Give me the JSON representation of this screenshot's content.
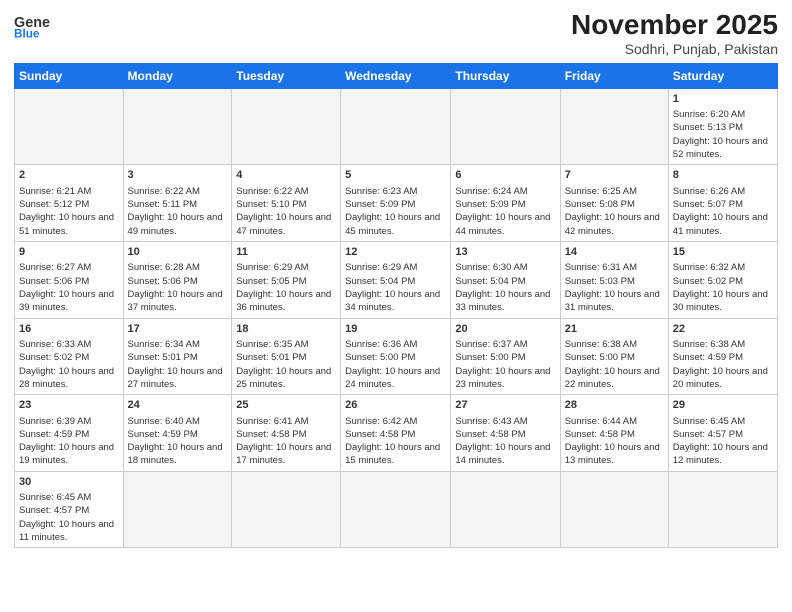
{
  "logo": {
    "text_general": "General",
    "text_blue": "Blue"
  },
  "header": {
    "month_year": "November 2025",
    "location": "Sodhri, Punjab, Pakistan"
  },
  "days_of_week": [
    "Sunday",
    "Monday",
    "Tuesday",
    "Wednesday",
    "Thursday",
    "Friday",
    "Saturday"
  ],
  "weeks": [
    [
      {
        "num": "",
        "info": ""
      },
      {
        "num": "",
        "info": ""
      },
      {
        "num": "",
        "info": ""
      },
      {
        "num": "",
        "info": ""
      },
      {
        "num": "",
        "info": ""
      },
      {
        "num": "",
        "info": ""
      },
      {
        "num": "1",
        "info": "Sunrise: 6:20 AM\nSunset: 5:13 PM\nDaylight: 10 hours and 52 minutes."
      }
    ],
    [
      {
        "num": "2",
        "info": "Sunrise: 6:21 AM\nSunset: 5:12 PM\nDaylight: 10 hours and 51 minutes."
      },
      {
        "num": "3",
        "info": "Sunrise: 6:22 AM\nSunset: 5:11 PM\nDaylight: 10 hours and 49 minutes."
      },
      {
        "num": "4",
        "info": "Sunrise: 6:22 AM\nSunset: 5:10 PM\nDaylight: 10 hours and 47 minutes."
      },
      {
        "num": "5",
        "info": "Sunrise: 6:23 AM\nSunset: 5:09 PM\nDaylight: 10 hours and 45 minutes."
      },
      {
        "num": "6",
        "info": "Sunrise: 6:24 AM\nSunset: 5:09 PM\nDaylight: 10 hours and 44 minutes."
      },
      {
        "num": "7",
        "info": "Sunrise: 6:25 AM\nSunset: 5:08 PM\nDaylight: 10 hours and 42 minutes."
      },
      {
        "num": "8",
        "info": "Sunrise: 6:26 AM\nSunset: 5:07 PM\nDaylight: 10 hours and 41 minutes."
      }
    ],
    [
      {
        "num": "9",
        "info": "Sunrise: 6:27 AM\nSunset: 5:06 PM\nDaylight: 10 hours and 39 minutes."
      },
      {
        "num": "10",
        "info": "Sunrise: 6:28 AM\nSunset: 5:06 PM\nDaylight: 10 hours and 37 minutes."
      },
      {
        "num": "11",
        "info": "Sunrise: 6:29 AM\nSunset: 5:05 PM\nDaylight: 10 hours and 36 minutes."
      },
      {
        "num": "12",
        "info": "Sunrise: 6:29 AM\nSunset: 5:04 PM\nDaylight: 10 hours and 34 minutes."
      },
      {
        "num": "13",
        "info": "Sunrise: 6:30 AM\nSunset: 5:04 PM\nDaylight: 10 hours and 33 minutes."
      },
      {
        "num": "14",
        "info": "Sunrise: 6:31 AM\nSunset: 5:03 PM\nDaylight: 10 hours and 31 minutes."
      },
      {
        "num": "15",
        "info": "Sunrise: 6:32 AM\nSunset: 5:02 PM\nDaylight: 10 hours and 30 minutes."
      }
    ],
    [
      {
        "num": "16",
        "info": "Sunrise: 6:33 AM\nSunset: 5:02 PM\nDaylight: 10 hours and 28 minutes."
      },
      {
        "num": "17",
        "info": "Sunrise: 6:34 AM\nSunset: 5:01 PM\nDaylight: 10 hours and 27 minutes."
      },
      {
        "num": "18",
        "info": "Sunrise: 6:35 AM\nSunset: 5:01 PM\nDaylight: 10 hours and 25 minutes."
      },
      {
        "num": "19",
        "info": "Sunrise: 6:36 AM\nSunset: 5:00 PM\nDaylight: 10 hours and 24 minutes."
      },
      {
        "num": "20",
        "info": "Sunrise: 6:37 AM\nSunset: 5:00 PM\nDaylight: 10 hours and 23 minutes."
      },
      {
        "num": "21",
        "info": "Sunrise: 6:38 AM\nSunset: 5:00 PM\nDaylight: 10 hours and 22 minutes."
      },
      {
        "num": "22",
        "info": "Sunrise: 6:38 AM\nSunset: 4:59 PM\nDaylight: 10 hours and 20 minutes."
      }
    ],
    [
      {
        "num": "23",
        "info": "Sunrise: 6:39 AM\nSunset: 4:59 PM\nDaylight: 10 hours and 19 minutes."
      },
      {
        "num": "24",
        "info": "Sunrise: 6:40 AM\nSunset: 4:59 PM\nDaylight: 10 hours and 18 minutes."
      },
      {
        "num": "25",
        "info": "Sunrise: 6:41 AM\nSunset: 4:58 PM\nDaylight: 10 hours and 17 minutes."
      },
      {
        "num": "26",
        "info": "Sunrise: 6:42 AM\nSunset: 4:58 PM\nDaylight: 10 hours and 15 minutes."
      },
      {
        "num": "27",
        "info": "Sunrise: 6:43 AM\nSunset: 4:58 PM\nDaylight: 10 hours and 14 minutes."
      },
      {
        "num": "28",
        "info": "Sunrise: 6:44 AM\nSunset: 4:58 PM\nDaylight: 10 hours and 13 minutes."
      },
      {
        "num": "29",
        "info": "Sunrise: 6:45 AM\nSunset: 4:57 PM\nDaylight: 10 hours and 12 minutes."
      }
    ],
    [
      {
        "num": "30",
        "info": "Sunrise: 6:45 AM\nSunset: 4:57 PM\nDaylight: 10 hours and 11 minutes."
      },
      {
        "num": "",
        "info": ""
      },
      {
        "num": "",
        "info": ""
      },
      {
        "num": "",
        "info": ""
      },
      {
        "num": "",
        "info": ""
      },
      {
        "num": "",
        "info": ""
      },
      {
        "num": "",
        "info": ""
      }
    ]
  ]
}
